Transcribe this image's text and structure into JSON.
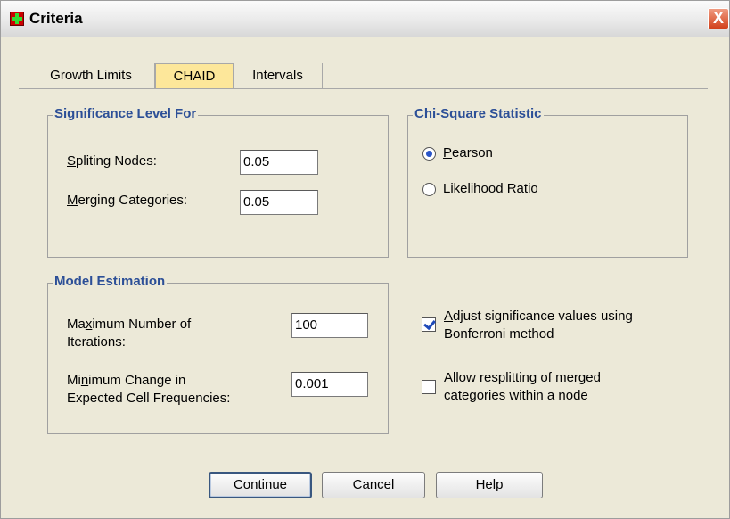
{
  "window": {
    "title": "Criteria",
    "close": "X"
  },
  "tabs": [
    "Growth Limits",
    "CHAID",
    "Intervals"
  ],
  "significance": {
    "title": "Significance Level For",
    "split_a": "S",
    "split_b": "pliting Nodes:",
    "split_value": "0.05",
    "merge_a": "M",
    "merge_b": "erging Categories:",
    "merge_value": "0.05"
  },
  "chisquare": {
    "title": "Chi-Square Statistic",
    "pearson_a": "P",
    "pearson_b": "earson",
    "likelihood_a": "L",
    "likelihood_b": "ikelihood Ratio",
    "selected": "Pearson"
  },
  "model": {
    "title": "Model Estimation",
    "maxiter_a": "Ma",
    "maxiter_u": "x",
    "maxiter_b": "imum Number of",
    "maxiter_line2": "Iterations:",
    "maxiter_value": "100",
    "minchange_a": "Mi",
    "minchange_u": "n",
    "minchange_b": "imum Change in",
    "minchange_line2": "Expected Cell Frequencies:",
    "minchange_value": "0.001"
  },
  "options": {
    "bonferroni_u": "A",
    "bonferroni_b": "djust significance values using",
    "bonferroni_line2": "Bonferroni method",
    "bonferroni_checked": true,
    "resplit_a": "Allo",
    "resplit_u": "w",
    "resplit_b": " resplitting of merged",
    "resplit_line2": "categories within a node",
    "resplit_checked": false
  },
  "buttons": {
    "continue": "Continue",
    "cancel": "Cancel",
    "help": "Help"
  }
}
